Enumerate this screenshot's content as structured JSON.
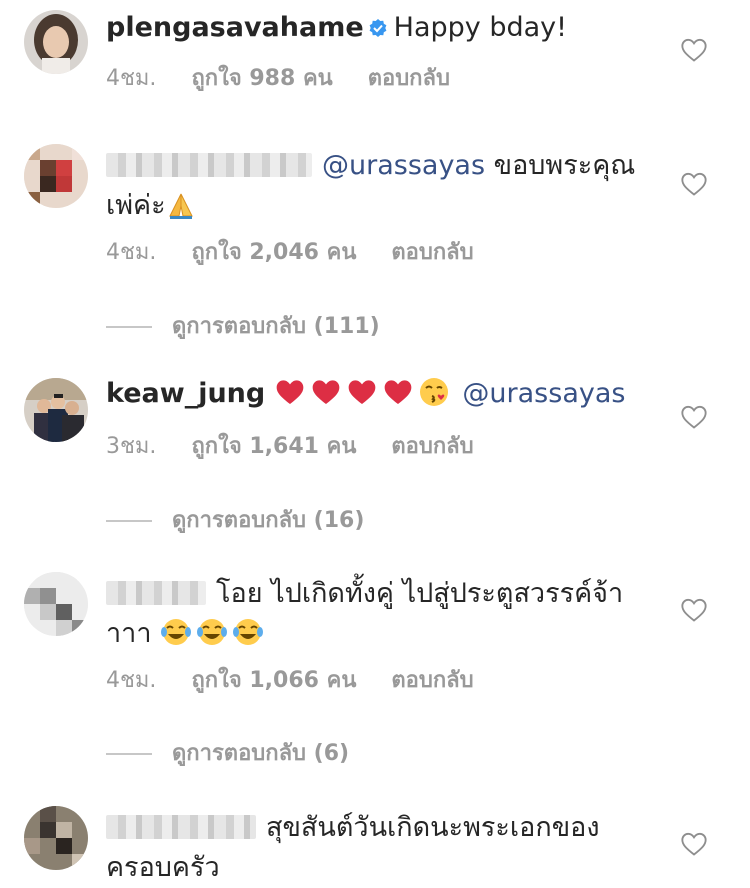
{
  "comments": [
    {
      "username": "plengasavahame",
      "verified": true,
      "text": "Happy bday!",
      "time": "4ชม.",
      "likes": "ถูกใจ 988 คน",
      "reply": "ตอบกลับ"
    },
    {
      "username": "",
      "mention": "@urassayas",
      "text": "ขอบพระคุณเพ่ค่ะ",
      "emoji": "🙏",
      "time": "4ชม.",
      "likes": "ถูกใจ 2,046 คน",
      "reply": "ตอบกลับ",
      "view_replies": "ดูการตอบกลับ (111)"
    },
    {
      "username": "keaw_jung",
      "emojis": [
        "red-heart",
        "red-heart",
        "red-heart",
        "red-heart",
        "kissing-face"
      ],
      "mention": "@urassayas",
      "time": "3ชม.",
      "likes": "ถูกใจ 1,641 คน",
      "reply": "ตอบกลับ",
      "view_replies": "ดูการตอบกลับ (16)"
    },
    {
      "username": "",
      "text": "โอย ไปเกิดทั้งคู่ ไปสู่ประตูสวรรค์จ้าาาา",
      "emojis": [
        "tears-of-joy",
        "tears-of-joy",
        "tears-of-joy"
      ],
      "time": "4ชม.",
      "likes": "ถูกใจ 1,066 คน",
      "reply": "ตอบกลับ",
      "view_replies": "ดูการตอบกลับ (6)"
    },
    {
      "username": "",
      "text": "สุขสันต์วันเกิดนะพระเอกของครอบครัว"
    }
  ],
  "colors": {
    "text": "#262626",
    "meta": "#999999",
    "mention": "#385185",
    "verified": "#3897f0",
    "heart_outline": "#8e8e8e"
  },
  "icons": [
    "verified-badge-icon",
    "like-heart-icon",
    "red-heart-emoji",
    "kissing-face-emoji",
    "tears-of-joy-emoji",
    "folded-hands-emoji"
  ]
}
